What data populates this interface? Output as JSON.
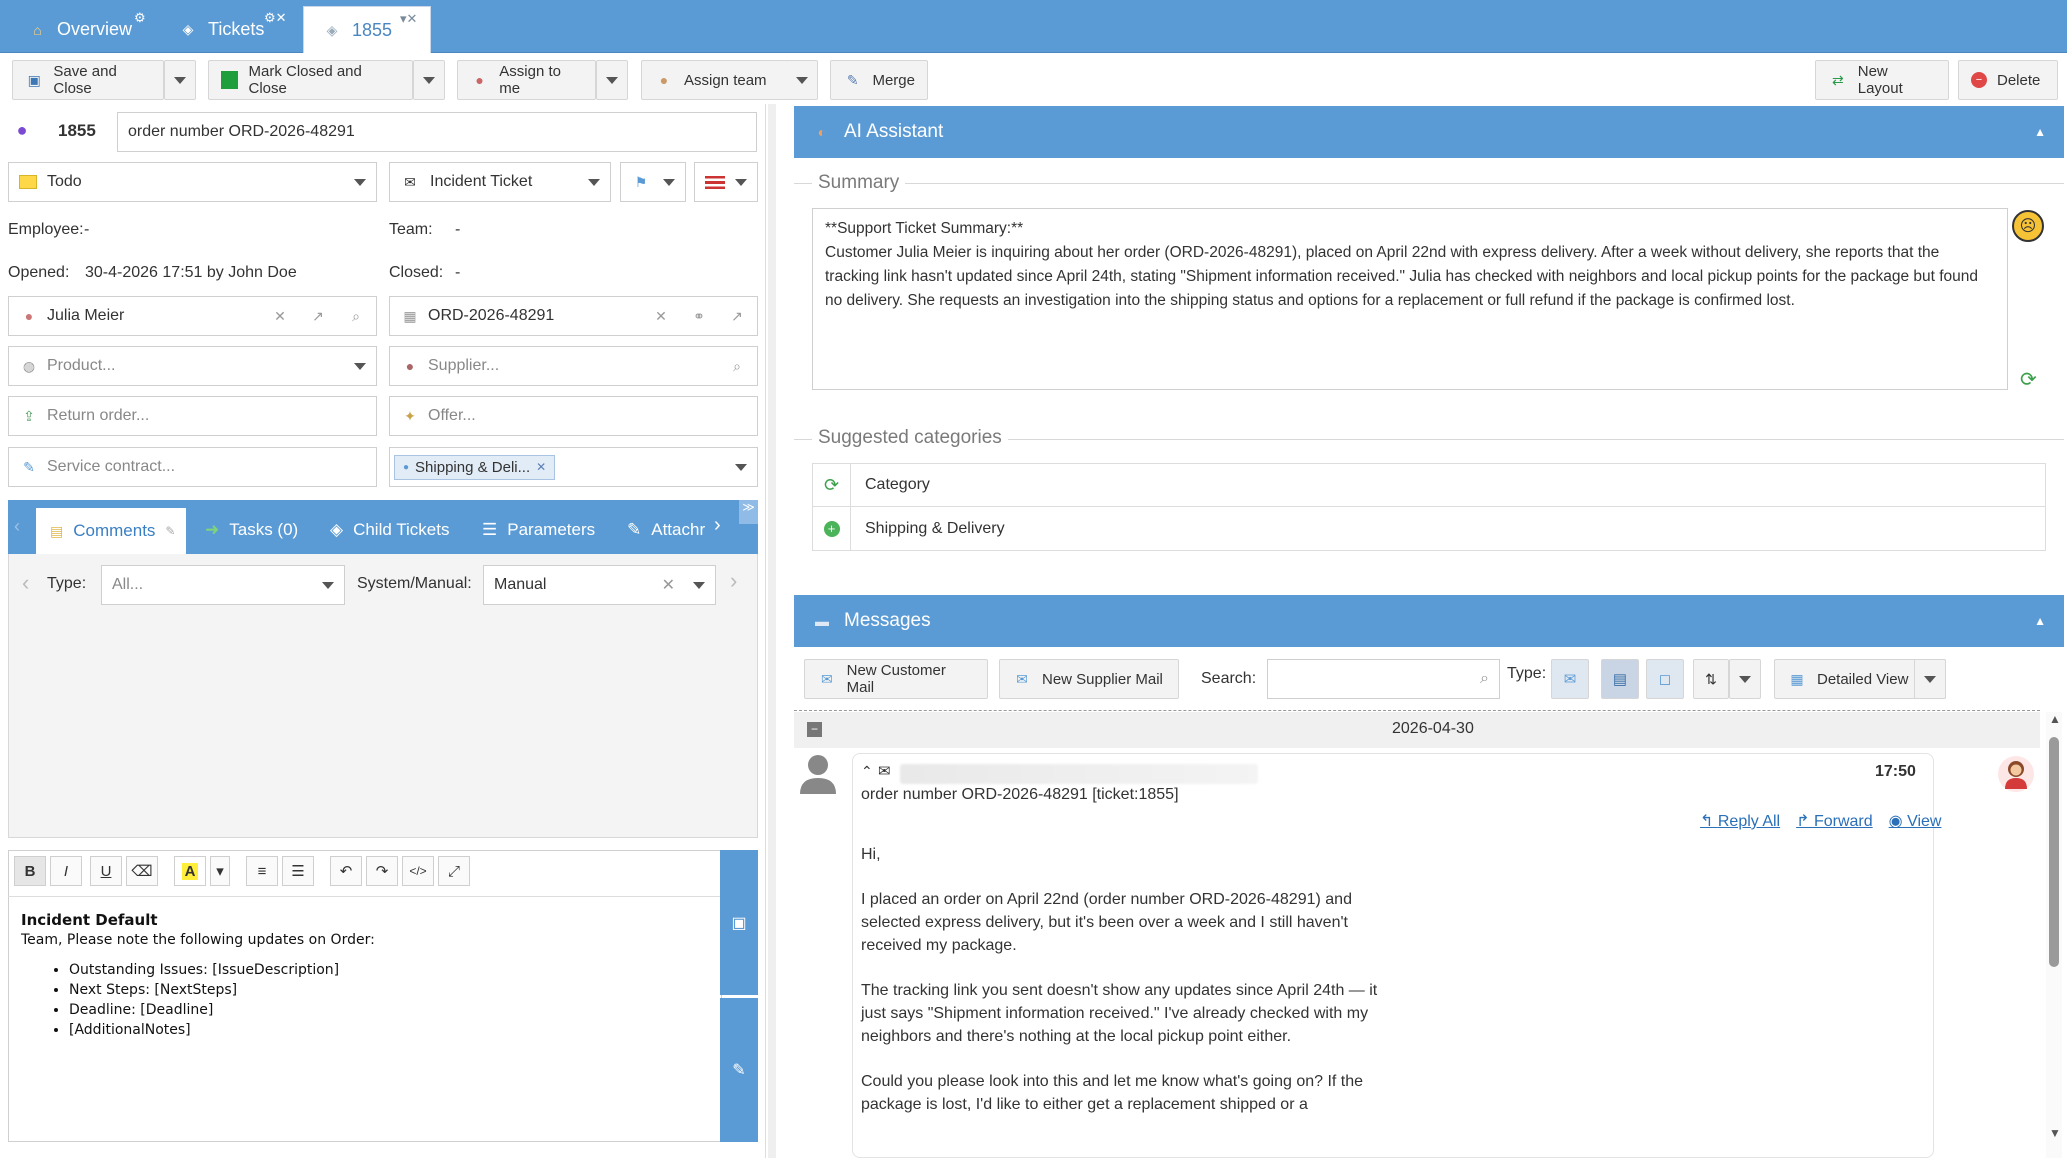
{
  "tabs": [
    {
      "label": "Overview"
    },
    {
      "label": "Tickets"
    },
    {
      "label": "1855"
    }
  ],
  "toolbar": {
    "save_close": "Save and Close",
    "mark_closed": "Mark Closed and Close",
    "assign_me": "Assign to me",
    "assign_team": "Assign team",
    "merge": "Merge",
    "new_layout": "New Layout",
    "delete": "Delete"
  },
  "ticket": {
    "number": "1855",
    "subject": "order number ORD-2026-48291",
    "status": "Todo",
    "type": "Incident Ticket",
    "employee_label": "Employee:",
    "employee_value": "-",
    "team_label": "Team:",
    "team_value": "-",
    "opened_label": "Opened:",
    "opened_value": "30-4-2026 17:51 by John Doe",
    "closed_label": "Closed:",
    "closed_value": "-",
    "customer": "Julia Meier",
    "order": "ORD-2026-48291",
    "product_ph": "Product...",
    "supplier_ph": "Supplier...",
    "return_ph": "Return order...",
    "offer_ph": "Offer...",
    "contract_ph": "Service contract...",
    "tag": "Shipping & Deli..."
  },
  "subtabs": {
    "comments": "Comments",
    "tasks": "Tasks (0)",
    "child": "Child Tickets",
    "parameters": "Parameters",
    "attach": "Attachr"
  },
  "filters": {
    "type_label": "Type:",
    "type_value": "All...",
    "sys_label": "System/Manual:",
    "sys_value": "Manual"
  },
  "editor": {
    "title": "Incident Default",
    "intro": "Team, Please note the following updates on Order:",
    "items": [
      "Outstanding Issues: [IssueDescription]",
      "Next Steps: [NextSteps]",
      "Deadline: [Deadline]",
      " [AdditionalNotes]"
    ]
  },
  "ai": {
    "title": "AI Assistant",
    "summary_label": "Summary",
    "summary_heading": "**Support Ticket Summary:**",
    "summary_text": "Customer Julia Meier is inquiring about her order (ORD-2026-48291), placed on April 22nd with express delivery. After a week without delivery, she reports that the tracking link hasn't updated since April 24th, stating \"Shipment information received.\" Julia has checked with neighbors and local pickup points for the package but found no delivery. She requests an investigation into the shipping status and options for a replacement or full refund if the package is confirmed lost.",
    "categories_label": "Suggested categories",
    "cat_header": "Category",
    "cat_row": "Shipping & Delivery"
  },
  "messages": {
    "title": "Messages",
    "new_customer_mail": "New Customer Mail",
    "new_supplier_mail": "New Supplier Mail",
    "search_label": "Search:",
    "search_value": "",
    "type_label": "Type:",
    "view": "Detailed View",
    "date": "2026-04-30",
    "time": "17:50",
    "subject": "order number ORD-2026-48291 [ticket:1855]",
    "reply_all": "Reply All",
    "forward": "Forward",
    "view_link": "View",
    "body": [
      "Hi,",
      "I placed an order on April 22nd (order number ORD-2026-48291) and selected express delivery, but it's been over a week and I still haven't received my package.",
      "The tracking link you sent doesn't show any updates since April 24th — it just says \"Shipment information received.\" I've already checked with my neighbors and there's nothing at the local pickup point either.",
      "Could you please look into this and let me know what's going on? If the package is lost, I'd like to either get a replacement shipped or a"
    ]
  },
  "colors": {
    "accent": "#5b9bd5",
    "link": "#2a6fb8"
  }
}
